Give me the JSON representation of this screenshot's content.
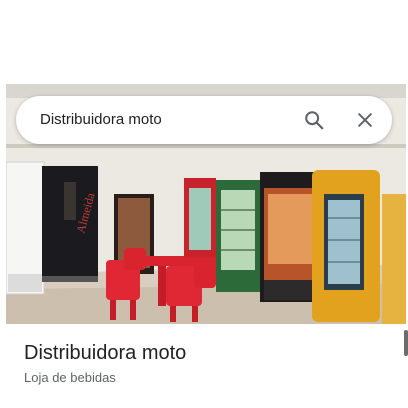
{
  "search": {
    "query": "Distribuidora moto",
    "search_icon": "search-icon",
    "close_icon": "close-icon"
  },
  "place": {
    "name": "Distribuidora moto",
    "category": "Loja de bebidas"
  },
  "photo": {
    "description_icon": "store-photo"
  }
}
